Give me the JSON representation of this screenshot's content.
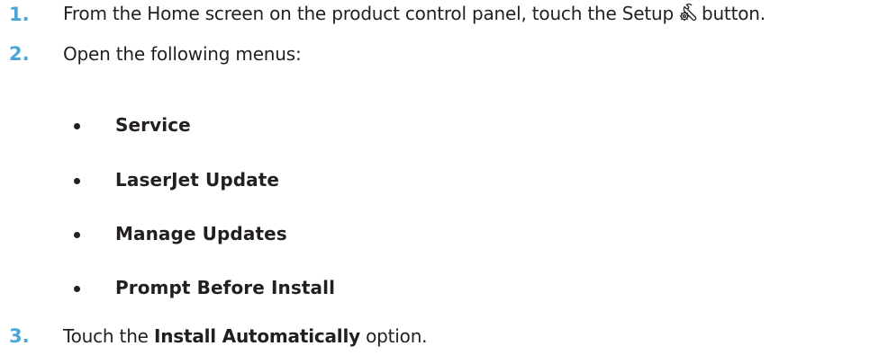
{
  "steps": [
    {
      "number": "1.",
      "text_before": "From the Home screen on the product control panel, touch the Setup",
      "icon": "setup-wrench-gear-icon",
      "text_after": "button."
    },
    {
      "number": "2.",
      "text": "Open the following menus:"
    },
    {
      "number": "3.",
      "text_before": "Touch the",
      "bold": "Install Automatically",
      "text_after": "option."
    }
  ],
  "menus": [
    "Service",
    "LaserJet Update",
    "Manage Updates",
    "Prompt Before Install"
  ],
  "colors": {
    "step_number": "#4aa6d9",
    "text": "#231f20"
  }
}
